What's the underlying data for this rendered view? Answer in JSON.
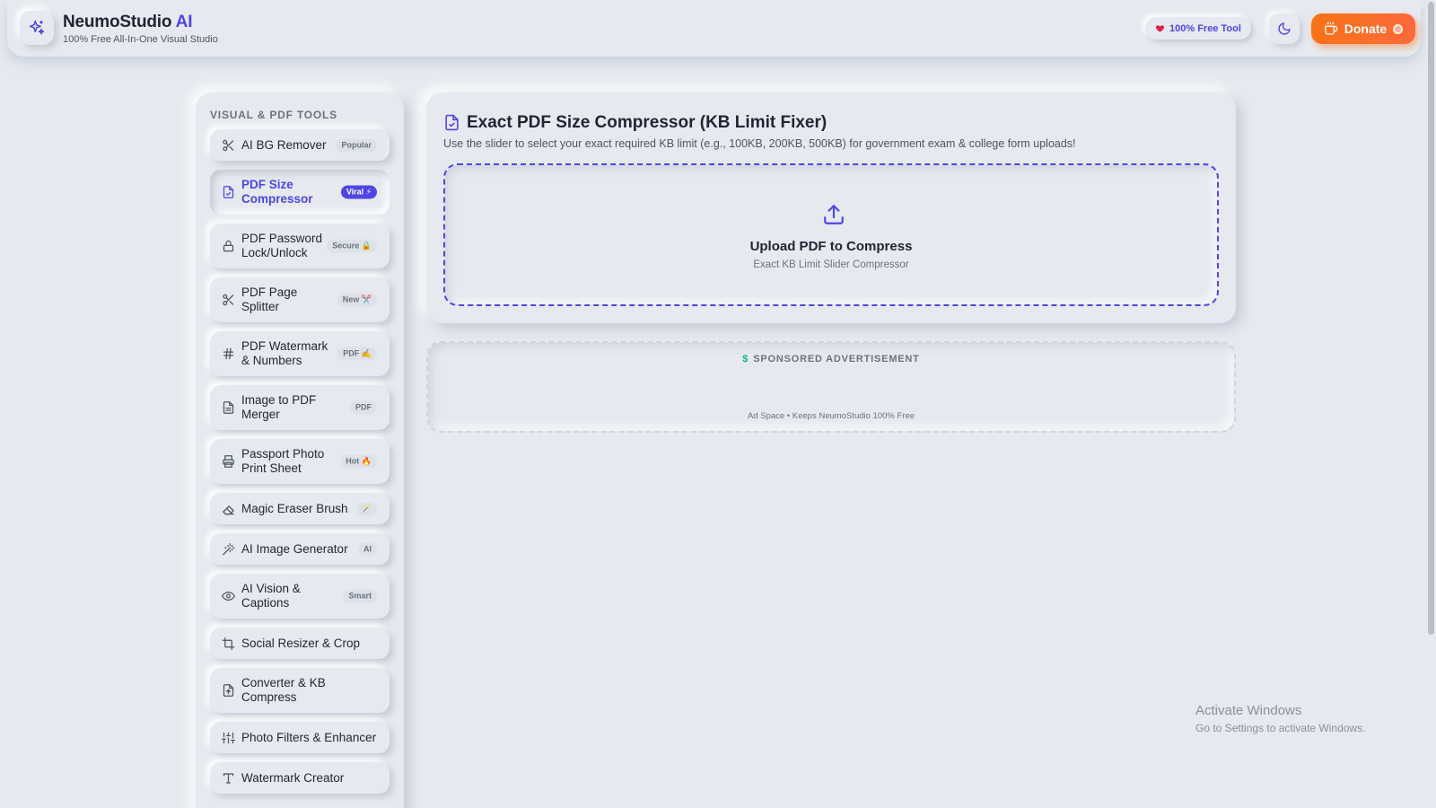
{
  "header": {
    "brand_name": "NeumoStudio",
    "brand_accent": "AI",
    "brand_subtitle": "100% Free All-In-One Visual Studio",
    "free_badge": "100% Free Tool",
    "donate_label": "Donate"
  },
  "sidebar": {
    "heading": "VISUAL & PDF TOOLS",
    "items": [
      {
        "label": "AI BG Remover",
        "badge": "Popular",
        "icon": "scissors-icon"
      },
      {
        "label": "PDF Size Compressor",
        "badge": "Viral ⚡",
        "icon": "file-check-icon",
        "active": true
      },
      {
        "label": "PDF Password Lock/Unlock",
        "badge": "Secure 🔒",
        "icon": "lock-icon"
      },
      {
        "label": "PDF Page Splitter",
        "badge": "New ✂️",
        "icon": "scissors-icon"
      },
      {
        "label": "PDF Watermark & Numbers",
        "badge": "PDF ✍️",
        "icon": "hash-icon"
      },
      {
        "label": "Image to PDF Merger",
        "badge": "PDF",
        "icon": "file-text-icon"
      },
      {
        "label": "Passport Photo Print Sheet",
        "badge": "Hot 🔥",
        "icon": "printer-icon"
      },
      {
        "label": "Magic Eraser Brush",
        "badge": "🪄",
        "icon": "eraser-icon"
      },
      {
        "label": "AI Image Generator",
        "badge": "AI",
        "icon": "magic-wand-icon"
      },
      {
        "label": "AI Vision & Captions",
        "badge": "Smart",
        "icon": "eye-icon"
      },
      {
        "label": "Social Resizer & Crop",
        "badge": "",
        "icon": "crop-icon"
      },
      {
        "label": "Converter & KB Compress",
        "badge": "",
        "icon": "file-convert-icon"
      },
      {
        "label": "Photo Filters & Enhancer",
        "badge": "",
        "icon": "sliders-icon"
      },
      {
        "label": "Watermark Creator",
        "badge": "",
        "icon": "type-icon"
      }
    ]
  },
  "main": {
    "title": "Exact PDF Size Compressor (KB Limit Fixer)",
    "description": "Use the slider to select your exact required KB limit (e.g., 100KB, 200KB, 500KB) for government exam & college form uploads!",
    "upload_title": "Upload PDF to Compress",
    "upload_subtitle": "Exact KB Limit Slider Compressor"
  },
  "ad": {
    "heading": "SPONSORED ADVERTISEMENT",
    "note": "Ad Space • Keeps NeumoStudio 100% Free"
  },
  "os_watermark": {
    "title": "Activate Windows",
    "subtitle": "Go to Settings to activate Windows."
  },
  "colors": {
    "accent": "#4f46e5",
    "donate": "#f97316",
    "background": "#e6e9ef"
  }
}
